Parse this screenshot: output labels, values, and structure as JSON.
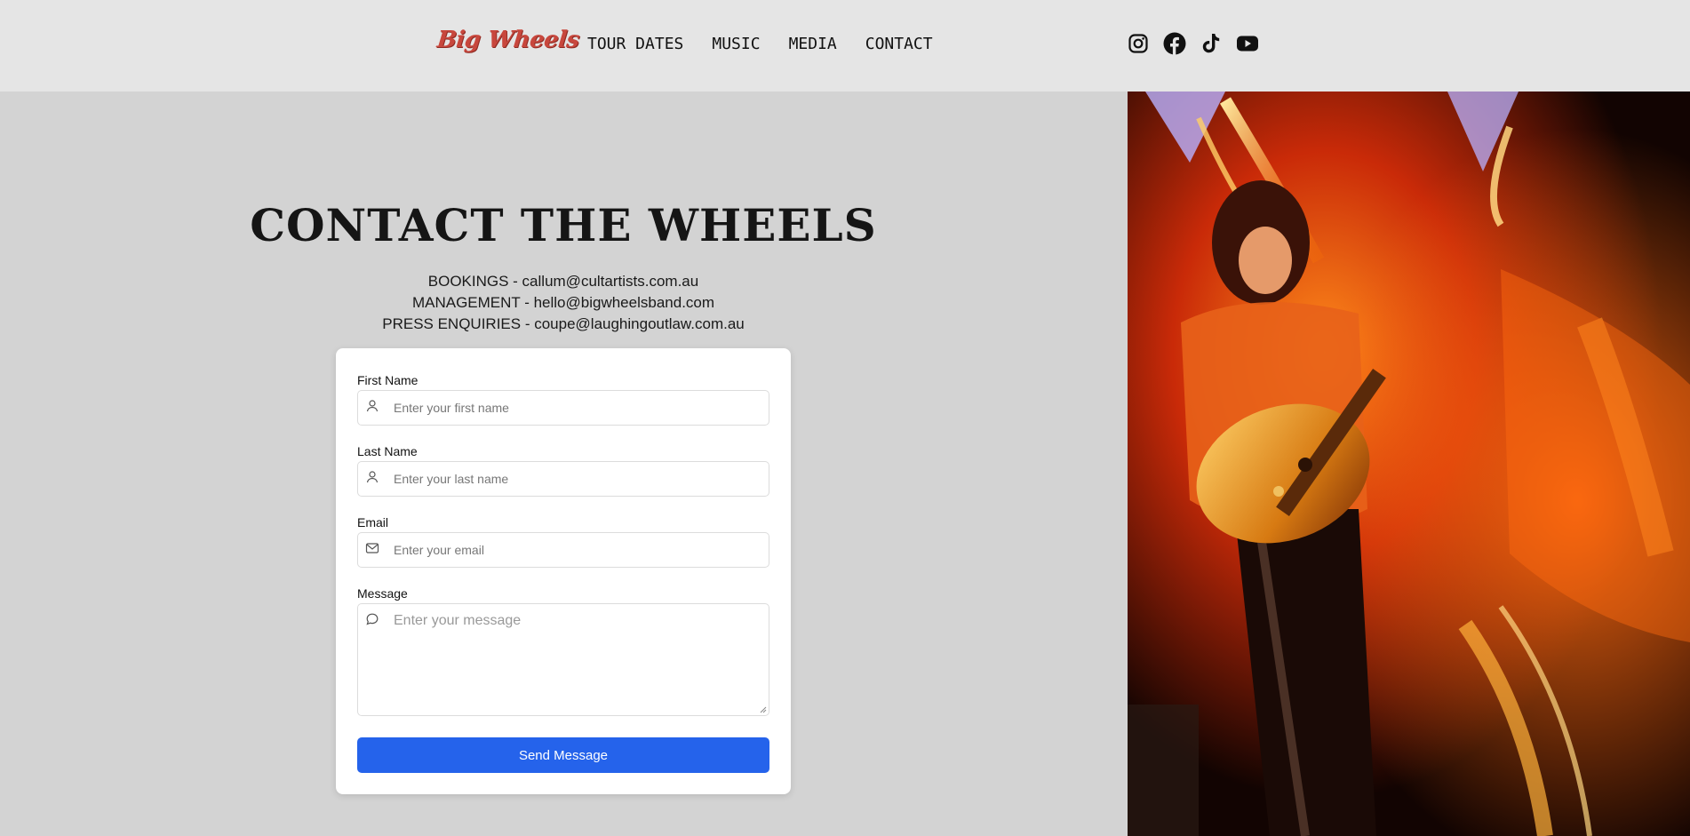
{
  "header": {
    "logo_text": "Big Wheels",
    "logo_color": "#c8473d",
    "nav": [
      {
        "label": "TOUR DATES"
      },
      {
        "label": "MUSIC"
      },
      {
        "label": "MEDIA"
      },
      {
        "label": "CONTACT"
      }
    ],
    "socials": [
      {
        "icon": "instagram-icon"
      },
      {
        "icon": "facebook-icon"
      },
      {
        "icon": "tiktok-icon"
      },
      {
        "icon": "youtube-icon"
      }
    ]
  },
  "main": {
    "title": "CONTACT THE WHEELS",
    "contacts": [
      "BOOKINGS - callum@cultartists.com.au",
      "MANAGEMENT - hello@bigwheelsband.com",
      "PRESS ENQUIRIES - coupe@laughingoutlaw.com.au"
    ]
  },
  "form": {
    "first_name": {
      "label": "First Name",
      "placeholder": "Enter your first name",
      "icon": "user-icon"
    },
    "last_name": {
      "label": "Last Name",
      "placeholder": "Enter your last name",
      "icon": "user-icon"
    },
    "email": {
      "label": "Email",
      "placeholder": "Enter your email",
      "icon": "mail-icon"
    },
    "message": {
      "label": "Message",
      "placeholder": "Enter your message",
      "icon": "chat-bubble-icon"
    },
    "submit_label": "Send Message",
    "accent": "#2563eb"
  },
  "photo": {
    "icon": "concert-guitarist-photo"
  }
}
